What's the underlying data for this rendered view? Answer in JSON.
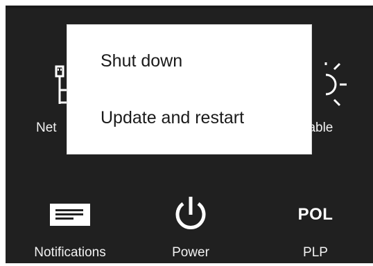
{
  "power_menu": {
    "items": [
      {
        "label": "Shut down"
      },
      {
        "label": "Update and restart"
      }
    ]
  },
  "quick_actions": {
    "network": {
      "label": "Net",
      "icon": "network-icon"
    },
    "brightness": {
      "label": "ilable",
      "icon": "brightness-icon"
    },
    "notifications": {
      "label": "Notifications",
      "icon": "notifications-icon"
    },
    "power": {
      "label": "Power",
      "icon": "power-icon"
    },
    "language": {
      "label": "PLP",
      "code": "POL",
      "icon": "keyboard-language-icon"
    }
  },
  "colors": {
    "panel_background": "#202020",
    "menu_background": "#ffffff",
    "icon_color": "#ffffff",
    "menu_text": "#1a1a1a"
  }
}
